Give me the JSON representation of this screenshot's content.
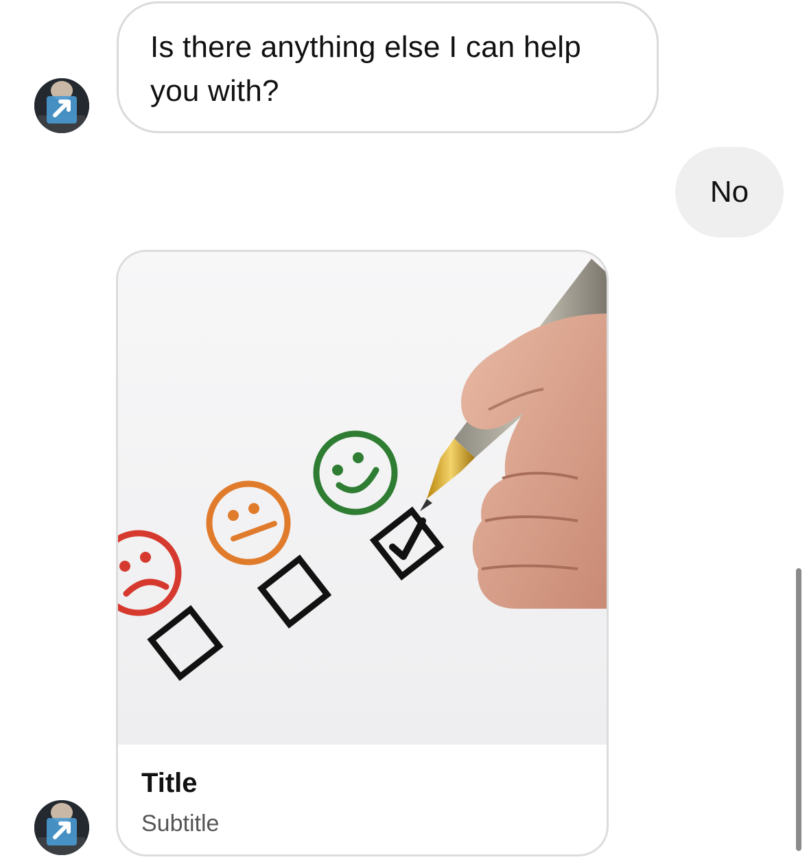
{
  "conversation": {
    "messages": [
      {
        "sender": "bot",
        "text": "Is there anything else I can help you with?"
      },
      {
        "sender": "user",
        "text": "No"
      }
    ],
    "card": {
      "image_description_icon": "satisfaction-survey-image",
      "title": "Title",
      "subtitle": "Subtitle"
    }
  },
  "colors": {
    "incoming_bubble_border": "#dadada",
    "outgoing_bubble_bg": "#efefef",
    "sad_face": "#d63a2f",
    "neutral_face": "#e07b2c",
    "happy_face": "#2e7d32",
    "text_primary": "#111111",
    "text_secondary": "#555555"
  },
  "icons": {
    "avatar": "bot-avatar-icon",
    "sad": "sad-face-icon",
    "neutral": "neutral-face-icon",
    "happy": "happy-face-icon",
    "checkbox": "checkbox-icon",
    "checkmark": "checkmark-icon",
    "pen": "pen-icon"
  }
}
